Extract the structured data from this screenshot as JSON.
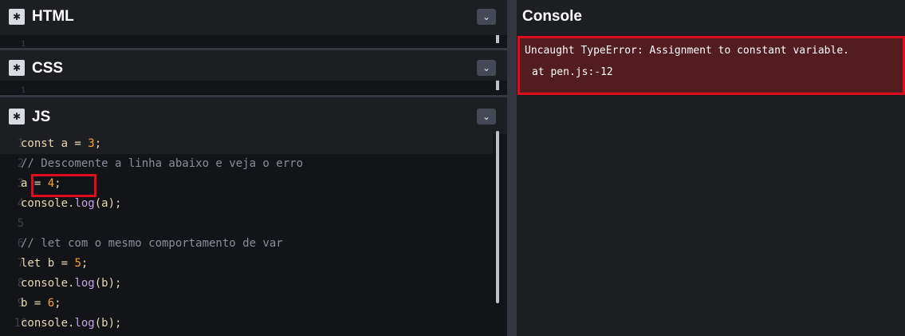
{
  "panels": {
    "html": {
      "title": "HTML",
      "settings_icon": "gear-icon",
      "collapse_icon": "chevron-down-icon",
      "line_number": "1"
    },
    "css": {
      "title": "CSS",
      "settings_icon": "gear-icon",
      "collapse_icon": "chevron-down-icon",
      "line_number": "1"
    },
    "js": {
      "title": "JS",
      "settings_icon": "gear-icon",
      "collapse_icon": "chevron-down-icon"
    }
  },
  "code": {
    "lines": [
      {
        "n": "1",
        "parts": [
          {
            "t": "const a = ",
            "c": "kw"
          },
          {
            "t": "3",
            "c": "num"
          },
          {
            "t": ";",
            "c": "kw"
          }
        ]
      },
      {
        "n": "2",
        "parts": [
          {
            "t": "// Descomente a linha abaixo e veja o erro",
            "c": "cm"
          }
        ]
      },
      {
        "n": "3",
        "parts": [
          {
            "t": "a = ",
            "c": "kw"
          },
          {
            "t": "4",
            "c": "num"
          },
          {
            "t": ";",
            "c": "kw"
          }
        ]
      },
      {
        "n": "4",
        "parts": [
          {
            "t": "console.",
            "c": "kw"
          },
          {
            "t": "log",
            "c": "fn"
          },
          {
            "t": "(a);",
            "c": "kw"
          }
        ]
      },
      {
        "n": "5",
        "parts": []
      },
      {
        "n": "6",
        "parts": [
          {
            "t": "// let com o mesmo comportamento de var",
            "c": "cm"
          }
        ]
      },
      {
        "n": "7",
        "parts": [
          {
            "t": "let b = ",
            "c": "kw"
          },
          {
            "t": "5",
            "c": "num"
          },
          {
            "t": ";",
            "c": "kw"
          }
        ]
      },
      {
        "n": "8",
        "parts": [
          {
            "t": "console.",
            "c": "kw"
          },
          {
            "t": "log",
            "c": "fn"
          },
          {
            "t": "(b);",
            "c": "kw"
          }
        ]
      },
      {
        "n": "9",
        "parts": [
          {
            "t": "b = ",
            "c": "kw"
          },
          {
            "t": "6",
            "c": "num"
          },
          {
            "t": ";",
            "c": "kw"
          }
        ]
      },
      {
        "n": "10",
        "parts": [
          {
            "t": "console.",
            "c": "kw"
          },
          {
            "t": "log",
            "c": "fn"
          },
          {
            "t": "(b);",
            "c": "kw"
          }
        ]
      }
    ]
  },
  "console": {
    "title": "Console",
    "error_message": "Uncaught TypeError: Assignment to constant variable.",
    "error_location": "at pen.js:-12"
  },
  "colors": {
    "highlight": "#e00c1d",
    "error_background": "#531d1f",
    "number": "#f7a533",
    "comment": "#8a8e9b",
    "function": "#c8a2e8"
  }
}
